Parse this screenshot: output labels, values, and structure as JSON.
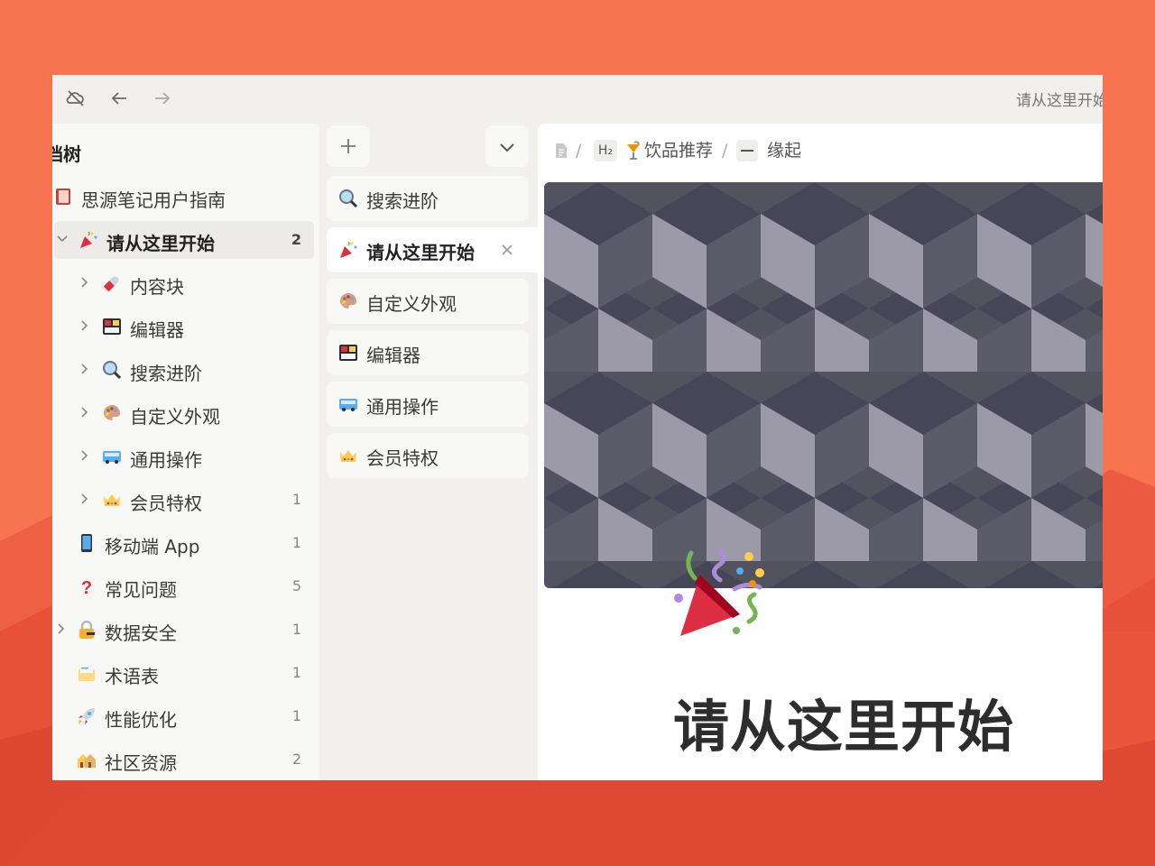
{
  "window": {
    "title": "请从这里开始"
  },
  "sidebar": {
    "title": "档树",
    "items": [
      {
        "label": "思源笔记用户指南",
        "icon": "book-icon",
        "count": ""
      },
      {
        "label": "请从这里开始",
        "icon": "party-popper-icon",
        "count": "2"
      },
      {
        "label": "内容块",
        "icon": "pill-icon",
        "count": ""
      },
      {
        "label": "编辑器",
        "icon": "bento-icon",
        "count": ""
      },
      {
        "label": "搜索进阶",
        "icon": "magnifier-icon",
        "count": ""
      },
      {
        "label": "自定义外观",
        "icon": "palette-icon",
        "count": ""
      },
      {
        "label": "通用操作",
        "icon": "bus-icon",
        "count": ""
      },
      {
        "label": "会员特权",
        "icon": "crown-icon",
        "count": "1"
      },
      {
        "label": "移动端 App",
        "icon": "phone-icon",
        "count": "1"
      },
      {
        "label": "常见问题",
        "icon": "question-icon",
        "count": "5"
      },
      {
        "label": "数据安全",
        "icon": "lock-key-icon",
        "count": "1"
      },
      {
        "label": "术语表",
        "icon": "card-index-icon",
        "count": "1"
      },
      {
        "label": "性能优化",
        "icon": "rocket-icon",
        "count": "1"
      },
      {
        "label": "社区资源",
        "icon": "houses-icon",
        "count": "2"
      }
    ]
  },
  "tabs": [
    {
      "label": "搜索进阶",
      "icon": "magnifier-icon"
    },
    {
      "label": "请从这里开始",
      "icon": "party-popper-icon"
    },
    {
      "label": "自定义外观",
      "icon": "palette-icon"
    },
    {
      "label": "编辑器",
      "icon": "bento-icon"
    },
    {
      "label": "通用操作",
      "icon": "bus-icon"
    },
    {
      "label": "会员特权",
      "icon": "crown-icon"
    }
  ],
  "breadcrumb": {
    "sep": "/",
    "heading_chip": "H₂",
    "item1": "饮品推荐",
    "item2": "缘起"
  },
  "document": {
    "title": "请从这里开始"
  },
  "colors": {
    "background": "#f87451",
    "accent": "#e8463a"
  }
}
